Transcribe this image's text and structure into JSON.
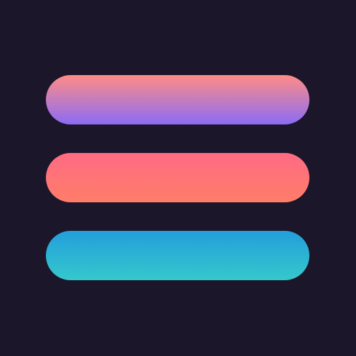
{
  "icon": {
    "name": "hamburger-menu-icon",
    "background_color": "#1b1629",
    "bars": [
      {
        "name": "top-bar",
        "gradient_top": "#ff8c87",
        "gradient_bottom": "#8b6cf5"
      },
      {
        "name": "middle-bar",
        "gradient_top": "#ff6b84",
        "gradient_bottom": "#ff7d68"
      },
      {
        "name": "bottom-bar",
        "gradient_top": "#239edb",
        "gradient_bottom": "#35c8cc"
      }
    ]
  }
}
